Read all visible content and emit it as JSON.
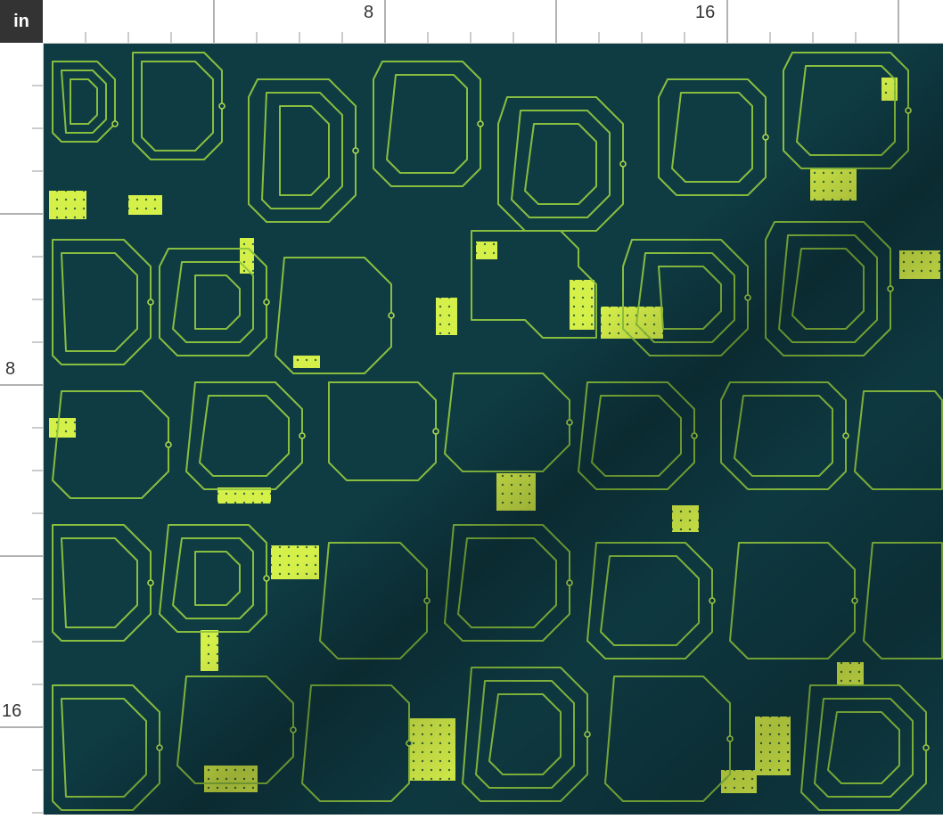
{
  "ruler": {
    "unit": "in",
    "top_labels": [
      "8",
      "16"
    ],
    "left_labels": [
      "8",
      "16"
    ]
  },
  "fabric": {
    "icon": "circuit-board-pattern",
    "background_color": "#0f3b43",
    "trace_color": "#a9d94a",
    "pad_color": "#d6f04a"
  }
}
